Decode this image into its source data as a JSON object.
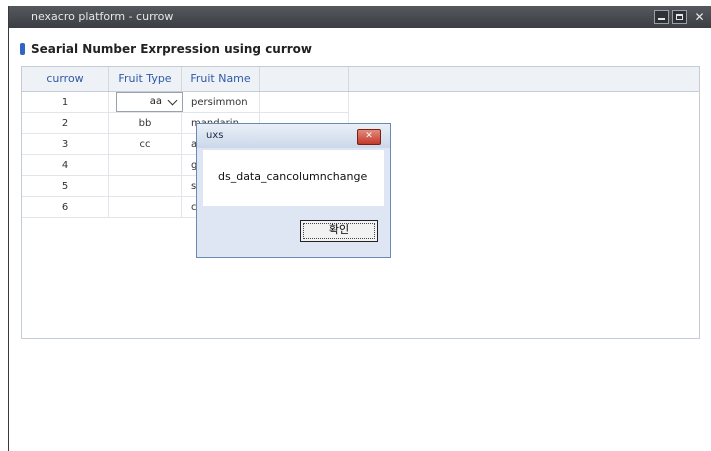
{
  "window": {
    "title": "nexacro platform - currow"
  },
  "heading": "Searial Number Exrpression using currow",
  "grid": {
    "columns": [
      "currow",
      "Fruit Type",
      "Fruit Name"
    ],
    "rows": [
      {
        "currow": "1",
        "type": "aa",
        "name": "persimmon"
      },
      {
        "currow": "2",
        "type": "bb",
        "name": "mandarin"
      },
      {
        "currow": "3",
        "type": "cc",
        "name": "app"
      },
      {
        "currow": "4",
        "type": "",
        "name": "gre"
      },
      {
        "currow": "5",
        "type": "",
        "name": "stra"
      },
      {
        "currow": "6",
        "type": "",
        "name": "che"
      }
    ]
  },
  "dialog": {
    "title": "uxs",
    "message": "ds_data_cancolumnchange",
    "ok_label": "확인"
  }
}
